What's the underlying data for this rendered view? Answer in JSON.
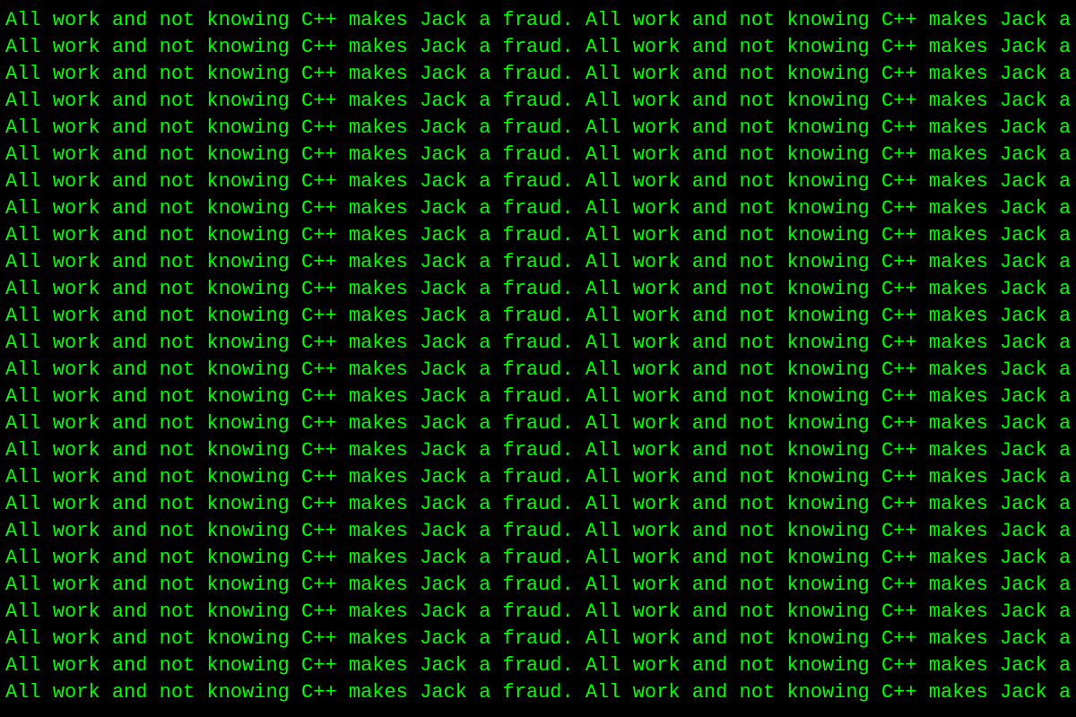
{
  "page": {
    "background_color": "#000000",
    "text_color": "#00ff00",
    "repeated_line": "All work and not knowing C++ makes Jack a fraud. All work and not knowing C++ makes Jack a fraud.",
    "line_count": 26
  }
}
